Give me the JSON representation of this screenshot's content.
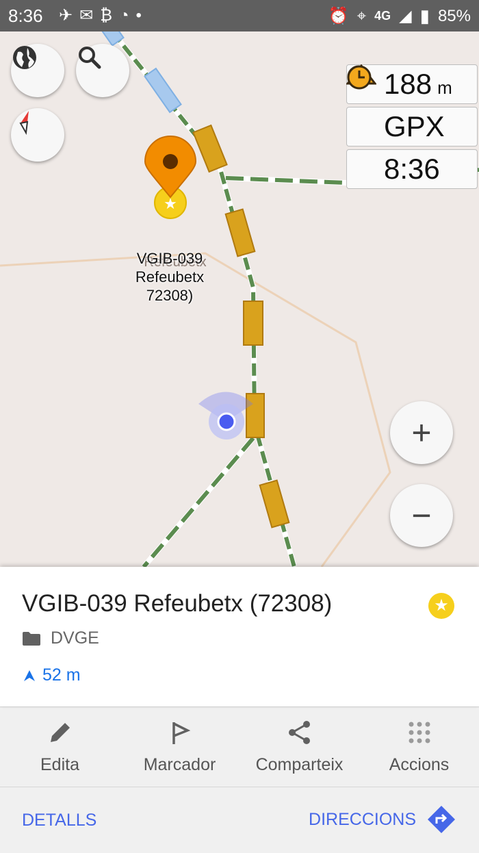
{
  "status_bar": {
    "time": "8:36",
    "network": "4G",
    "battery": "85%",
    "icons": [
      "telegram-icon",
      "mail-icon",
      "bitcoin-icon",
      "wifi-icon",
      "dot-icon",
      "alarm-icon",
      "location-icon",
      "signal-icon",
      "battery-icon"
    ]
  },
  "widgets": {
    "altitude": {
      "value": "188",
      "unit": "m",
      "icon": "mountain-icon"
    },
    "gpx": {
      "value": "GPX",
      "icon": "record-icon"
    },
    "clock": {
      "value": "8:36",
      "icon": "clock-icon"
    }
  },
  "map": {
    "poi_label": "VGIB-039\nRefeubetx\n72308)",
    "poi_ghost_label": "Refeubetx",
    "controls": [
      "globe-icon",
      "search-icon",
      "compass-icon"
    ],
    "zoom_in": "+",
    "zoom_out": "−"
  },
  "point": {
    "title": "VGIB-039 Refeubetx (72308)",
    "folder": "DVGE",
    "distance": "52 m"
  },
  "actions": [
    {
      "label": "Edita",
      "icon": "pencil-icon"
    },
    {
      "label": "Marcador",
      "icon": "flag-icon"
    },
    {
      "label": "Comparteix",
      "icon": "share-icon"
    },
    {
      "label": "Accions",
      "icon": "grid-icon"
    }
  ],
  "bottom": {
    "details": "DETALLS",
    "directions": "DIRECCIONS"
  },
  "colors": {
    "accent": "#4667e8",
    "distance": "#1a73e8",
    "marker": "#f28c00",
    "star": "#f6cf1c",
    "track": "#5b8c4f",
    "bridge": "#d9a21d"
  }
}
